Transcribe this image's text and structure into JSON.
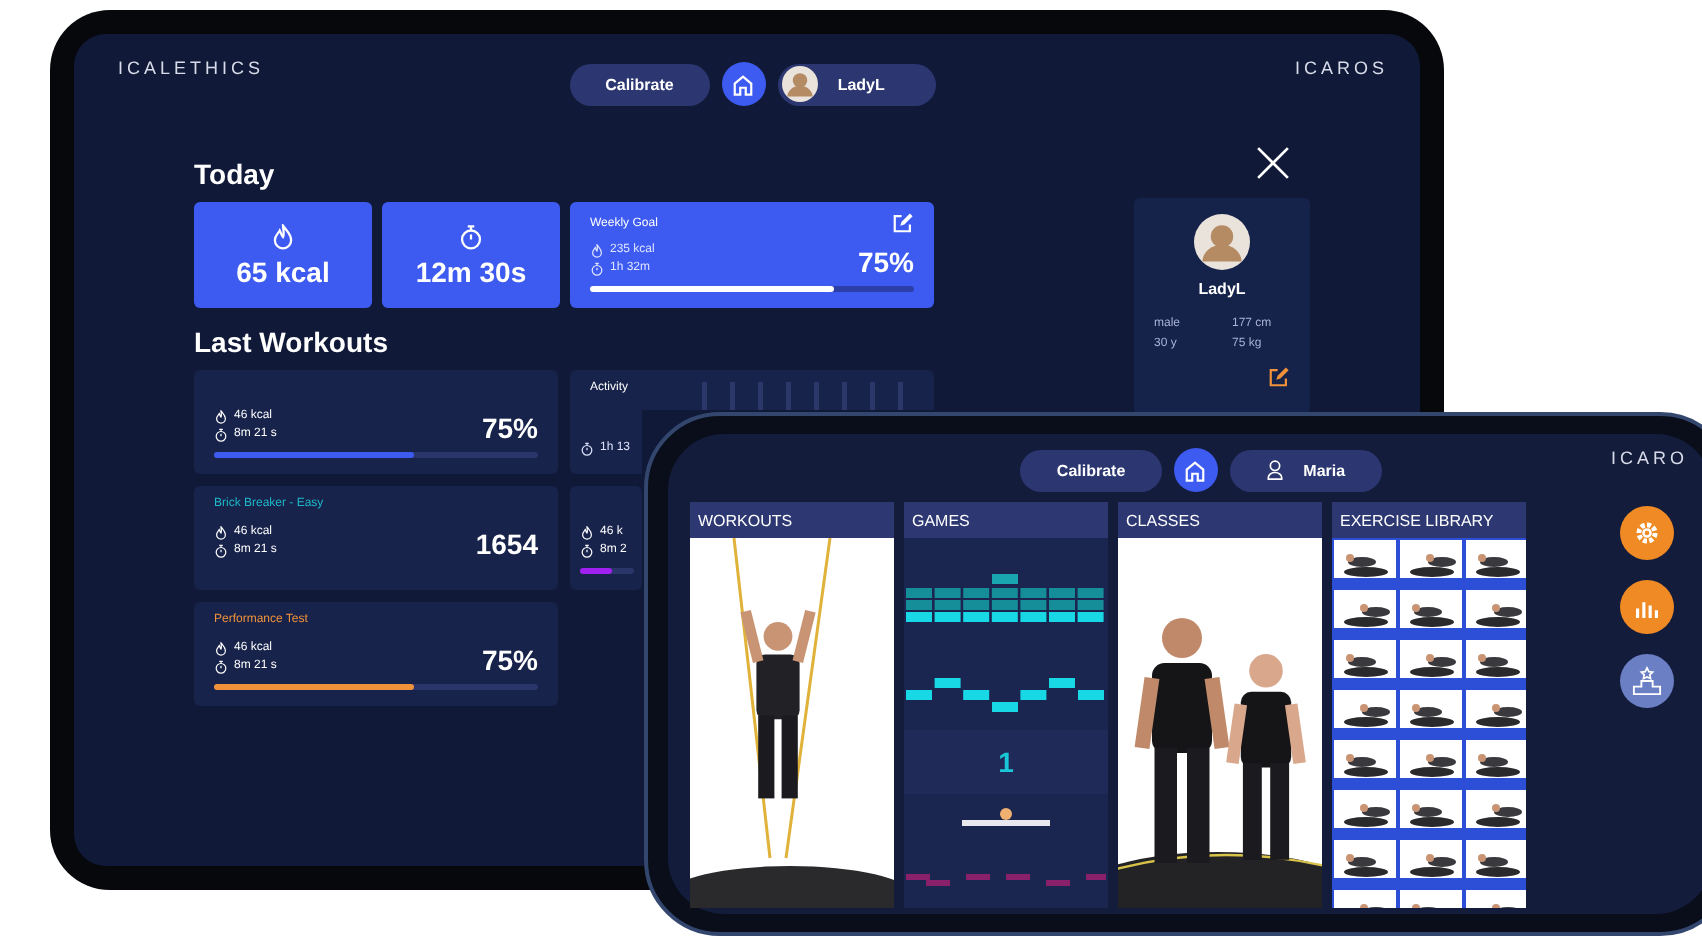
{
  "tablet": {
    "brand_left": "ICALETHICS",
    "brand_right": "ICAROS",
    "calibrate": "Calibrate",
    "user": "LadyL",
    "today_title": "Today",
    "tiles": [
      {
        "kind": "calories",
        "value": "65 kcal"
      },
      {
        "kind": "time",
        "value": "12m 30s"
      }
    ],
    "weekly_goal": {
      "title": "Weekly Goal",
      "calories": "235 kcal",
      "duration": "1h 32m",
      "percent": "75%",
      "level": 0.75
    },
    "workouts_title": "Last Workouts",
    "workouts": [
      {
        "kind": "result",
        "color": "#3d5af1",
        "calories": "46 kcal",
        "duration": "8m 21 s",
        "result": "75%",
        "level": 0.62
      },
      {
        "kind": "result",
        "title": "Brick Breaker - Easy",
        "color": "#1fb8c9",
        "calories": "46 kcal",
        "duration": "8m 21 s",
        "result": "1654"
      },
      {
        "kind": "result",
        "title": "Performance Test",
        "color": "#f0923a",
        "calories": "46 kcal",
        "duration": "8m 21 s",
        "result": "75%",
        "level": 0.62
      }
    ],
    "side_cards": [
      {
        "kind": "activity",
        "title": "Activity",
        "duration": "1h 13"
      },
      {
        "kind": "result",
        "color": "#a020f0",
        "calories": "46 k",
        "duration": "8m 2",
        "level": 0.6
      }
    ],
    "profile": {
      "name": "LadyL",
      "stats": [
        "male",
        "177 cm",
        "30 y",
        "75 kg"
      ]
    }
  },
  "phone": {
    "calibrate": "Calibrate",
    "user": "Maria",
    "brand": "ICARO",
    "panels": [
      {
        "kind": "picture",
        "title": "WORKOUTS"
      },
      {
        "kind": "game",
        "title": "GAMES",
        "score": "1"
      },
      {
        "kind": "picture",
        "title": "CLASSES"
      },
      {
        "kind": "library",
        "title": "EXERCISE LIBRARY"
      }
    ],
    "side_buttons": [
      {
        "kind": "settings",
        "color": "#f08a24"
      },
      {
        "kind": "stats",
        "color": "#f08a24"
      },
      {
        "kind": "podium",
        "color": "#6b7fc4"
      }
    ]
  }
}
